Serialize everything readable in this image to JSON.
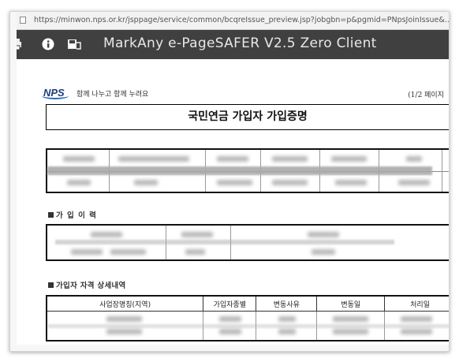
{
  "browser": {
    "url": "https://minwon.nps.or.kr/jsppage/service/common/bcqreIssue_preview.jsp?jobgbn=p&pgmid=PNpsJoinIssue&..."
  },
  "viewer": {
    "title": "MarkAny e-PageSAFER V2.5 Zero Client",
    "icons": [
      "print-icon",
      "info-icon",
      "save-icon"
    ]
  },
  "document": {
    "logo_text": "NPS",
    "slogan": "함께 나누고 함께 누려요",
    "page_indicator": "(1/2 페이지",
    "title": "국민연금 가입자 가입증명",
    "section_history": "가 입 이 력",
    "section_detail": "가입자 자격 상세내역",
    "detail_table": {
      "headers": [
        "사업장명칭(지역)",
        "가입자종별",
        "변동사유",
        "변동일",
        "처리일"
      ]
    }
  }
}
